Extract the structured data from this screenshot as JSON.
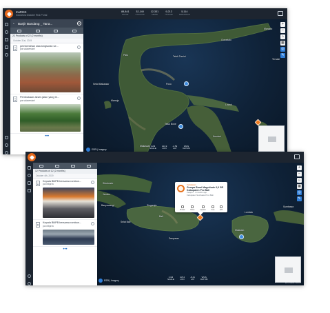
{
  "app": {
    "name": "InaRISK",
    "subtitle": "Indonesia Disaster Risk Portal",
    "header_stats": [
      {
        "value": "88,841",
        "label": "BANJIR"
      },
      {
        "value": "32,140",
        "label": "LONGSOR"
      },
      {
        "value": "12,331",
        "label": "GEMPA"
      },
      {
        "value": "9,212",
        "label": "TSUNAMI"
      },
      {
        "value": "5,114",
        "label": "KEBAKARAN"
      }
    ]
  },
  "screen1": {
    "panel_title": "Banjir Bandang _ Tana...",
    "count_text": "22 Products of 22 (2 months)",
    "date_header": "October 31st, 2019",
    "items": [
      {
        "title": "pembersihan sisa longsoran se...",
        "author": "por.sulawesisel"
      },
      {
        "title": "Pembukaan akses jalan yang te...",
        "author": "por.sulawesisel"
      }
    ],
    "map_labels": [
      "Manado",
      "Gorontalo",
      "Palu",
      "Kendari",
      "Makassar",
      "Selat Makassar",
      "Teluk Tomini",
      "Teluk Bone",
      "Luwuk",
      "Poso",
      "Mamuju",
      "Ternate"
    ],
    "brand": "ESRI | Imagery",
    "scale": [
      {
        "v": "1:2M",
        "l": "SCALE"
      },
      {
        "v": "121.9",
        "l": "LON"
      },
      {
        "v": "-2.59",
        "l": "LAT"
      },
      {
        "v": "WGS",
        "l": "DATUM"
      }
    ],
    "attribution": "Esri, HERE, Garmin"
  },
  "screen2": {
    "count_text": "12 Products of 12 (2 months)",
    "date_header": "October 4th, 2019",
    "items": [
      {
        "title": "Kepala BNPB bersama rombon...",
        "author": "por.ntbprov"
      },
      {
        "title": "Kepala BNPB bersama rombon...",
        "author": "por.ntbprov"
      }
    ],
    "popup": {
      "label": "Kebakaran",
      "title": "Gempa Bumi Magnitude 6,0 SR Kabupaten Pro Bali",
      "meta": "Pelapor · 4 months ago",
      "meta2": "Kabupaten Sumbawa Prov Bali",
      "actions": [
        "Produk",
        "Share",
        "Laporan",
        "Foto",
        "Edit"
      ]
    },
    "map_labels": [
      "Lombok",
      "Bali",
      "Mataram",
      "Denpasar",
      "Sumbawa",
      "Selat Bali",
      "Banyuwangi",
      "Singaraja",
      "Situbondo",
      "Jember"
    ],
    "brand": "ESRI | Imagery",
    "scale": [
      {
        "v": "1:1M",
        "l": "SCALE"
      },
      {
        "v": "115.2",
        "l": "LON"
      },
      {
        "v": "-8.41",
        "l": "LAT"
      },
      {
        "v": "WGS",
        "l": "DATUM"
      }
    ],
    "attribution": "Esri, HERE, Garmin"
  }
}
